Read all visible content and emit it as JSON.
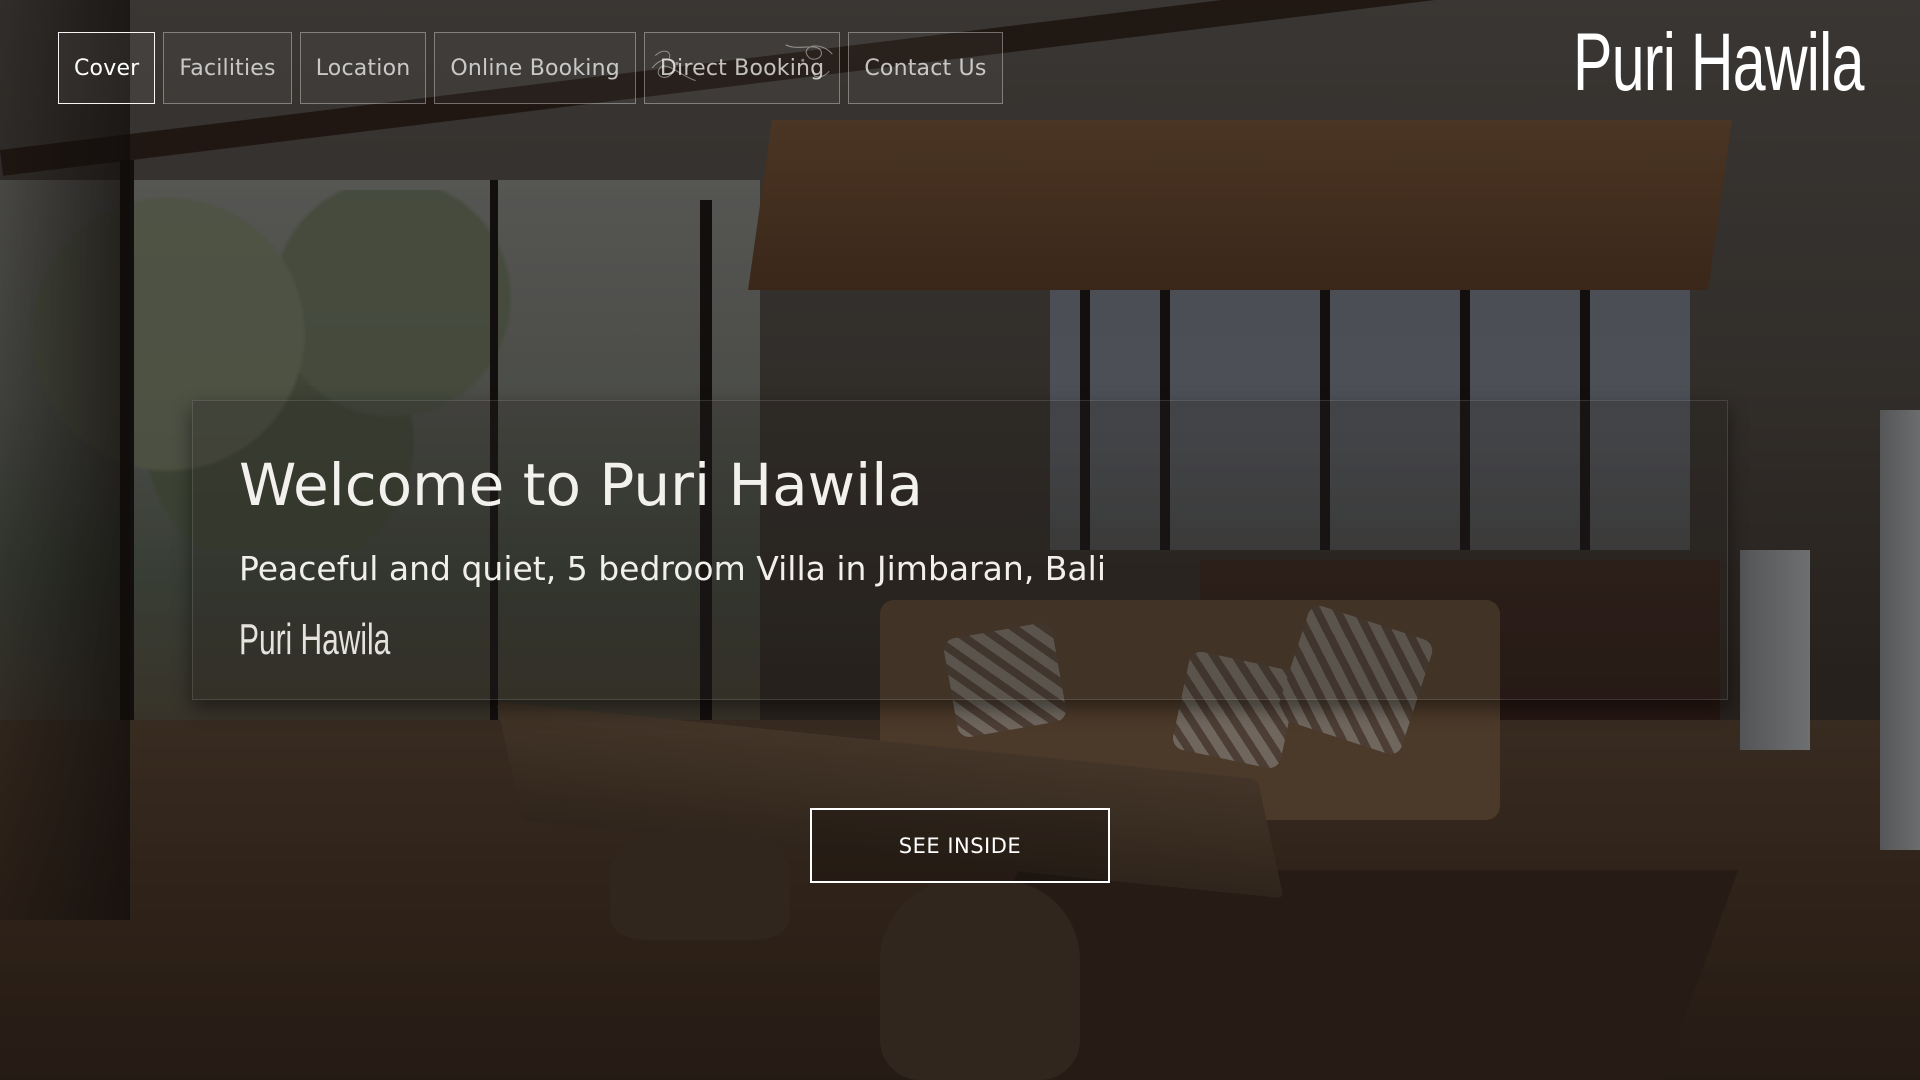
{
  "nav": {
    "items": [
      {
        "label": "Cover",
        "active": true
      },
      {
        "label": "Facilities",
        "active": false
      },
      {
        "label": "Location",
        "active": false
      },
      {
        "label": "Online Booking",
        "active": false
      },
      {
        "label": "Direct Booking",
        "active": false,
        "decoration": "flourish"
      },
      {
        "label": "Contact Us",
        "active": false
      }
    ]
  },
  "brand": {
    "name": "Puri Hawila"
  },
  "hero": {
    "title": "Welcome to Puri Hawila",
    "subtitle": "Peaceful and quiet, 5 bedroom Villa in Jimbaran, Bali",
    "signature": "Puri Hawila"
  },
  "cta": {
    "label": "SEE INSIDE"
  },
  "background": {
    "subject": "villa living room interior photo",
    "overlay_color": "#0a0806"
  }
}
